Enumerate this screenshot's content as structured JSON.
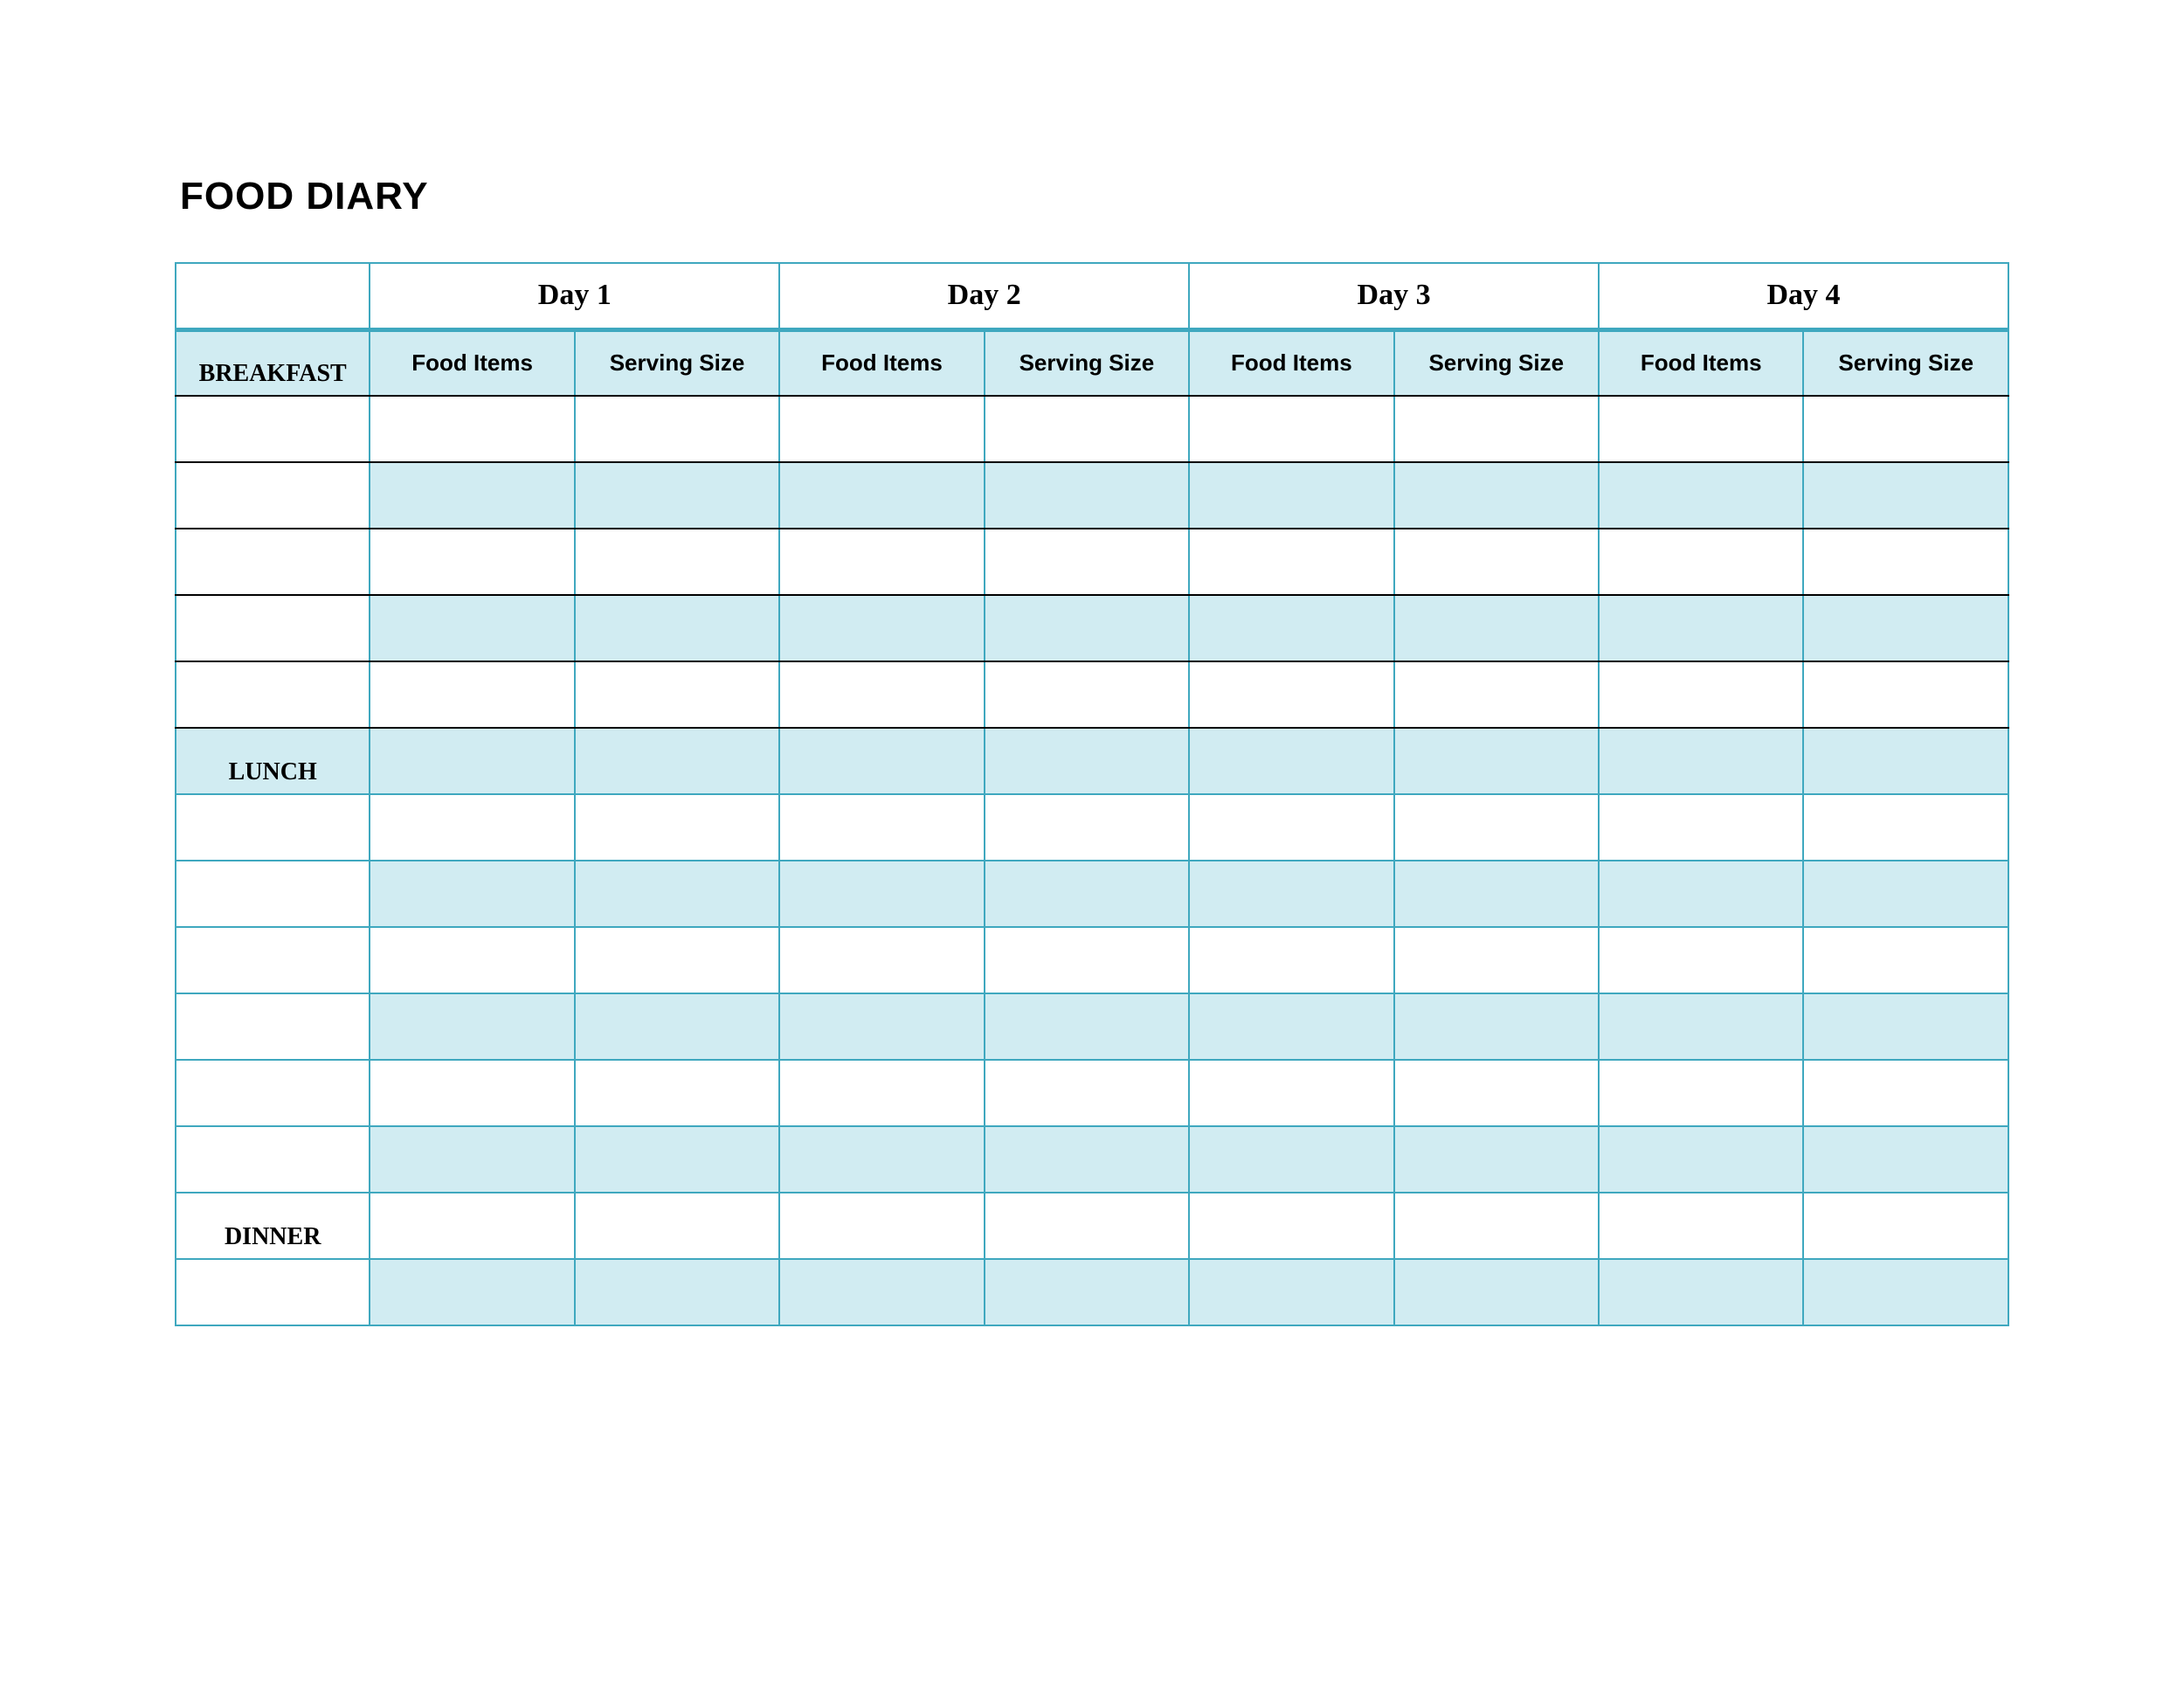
{
  "title": "FOOD DIARY",
  "days": [
    "Day 1",
    "Day 2",
    "Day 3",
    "Day 4"
  ],
  "subheaders": {
    "food": "Food Items",
    "serving": "Serving Size"
  },
  "meals": {
    "breakfast": "BREAKFAST",
    "lunch": "LUNCH",
    "dinner": "DINNER"
  },
  "colors": {
    "border": "#3fa8bf",
    "shade": "#d1ecf2"
  }
}
